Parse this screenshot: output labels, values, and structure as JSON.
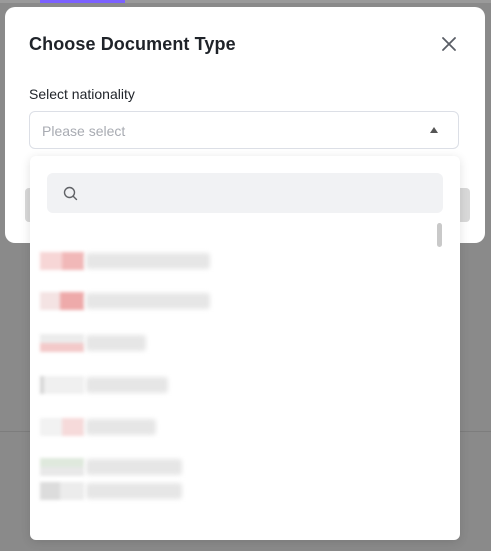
{
  "modal": {
    "title": "Choose Document Type",
    "field_label": "Select nationality",
    "select_placeholder": "Please select"
  },
  "dropdown": {
    "search_value": "",
    "options": [
      {
        "label": ""
      },
      {
        "label": ""
      },
      {
        "label": ""
      },
      {
        "label": ""
      },
      {
        "label": ""
      },
      {
        "label": ""
      },
      {
        "label": ""
      }
    ]
  },
  "colors": {
    "backdrop": "#8a8a8a",
    "modal_bg": "#ffffff",
    "title_text": "#1f2329",
    "placeholder_text": "#a8abb2",
    "search_bg": "#f1f2f4",
    "accent": "#7b61ff"
  },
  "icons": [
    "close-icon",
    "caret-up-icon",
    "search-icon"
  ]
}
